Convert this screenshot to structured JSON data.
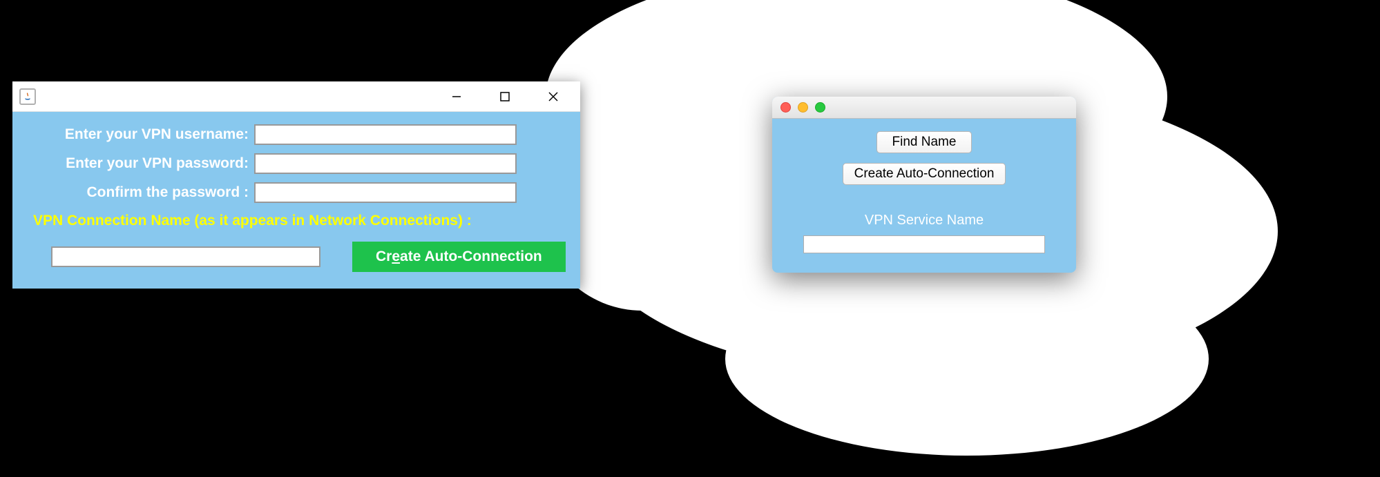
{
  "win": {
    "username_label": "Enter your VPN username:",
    "password_label": "Enter your VPN password:",
    "confirm_label": "Confirm the password :",
    "connection_name_label": "VPN Connection Name (as it appears in Network Connections) :",
    "create_button_prefix": "Cr",
    "create_button_underlined": "e",
    "create_button_suffix": "ate Auto-Connection",
    "username_value": "",
    "password_value": "",
    "confirm_value": "",
    "connection_name_value": ""
  },
  "mac": {
    "find_name_button": "Find Name",
    "create_button": "Create Auto-Connection",
    "service_label": "VPN Service Name",
    "service_value": ""
  }
}
